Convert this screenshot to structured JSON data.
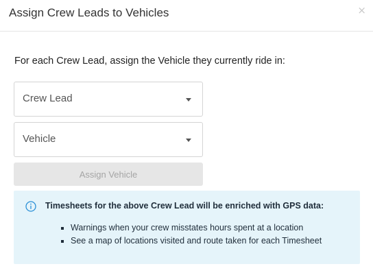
{
  "dialog": {
    "title": "Assign Crew Leads to Vehicles",
    "close_symbol": "×",
    "instruction": "For each Crew Lead, assign the Vehicle they currently ride in:"
  },
  "form": {
    "crew_lead_select": {
      "value": "Crew Lead",
      "icon": "chevron-down-icon"
    },
    "vehicle_select": {
      "value": "Vehicle",
      "icon": "chevron-down-icon"
    },
    "assign_button_label": "Assign Vehicle"
  },
  "info": {
    "icon": "info-icon",
    "heading": "Timesheets for the above Crew Lead will be enriched with GPS data:",
    "items": [
      "Warnings when your crew misstates hours spent at a location",
      "See a map of locations visited and route taken for each Timesheet"
    ]
  },
  "colors": {
    "info_background": "#e5f4fa",
    "info_icon": "#2a8fd6",
    "disabled_button_background": "#e6e6e6",
    "disabled_button_text": "#a5a5a5"
  }
}
